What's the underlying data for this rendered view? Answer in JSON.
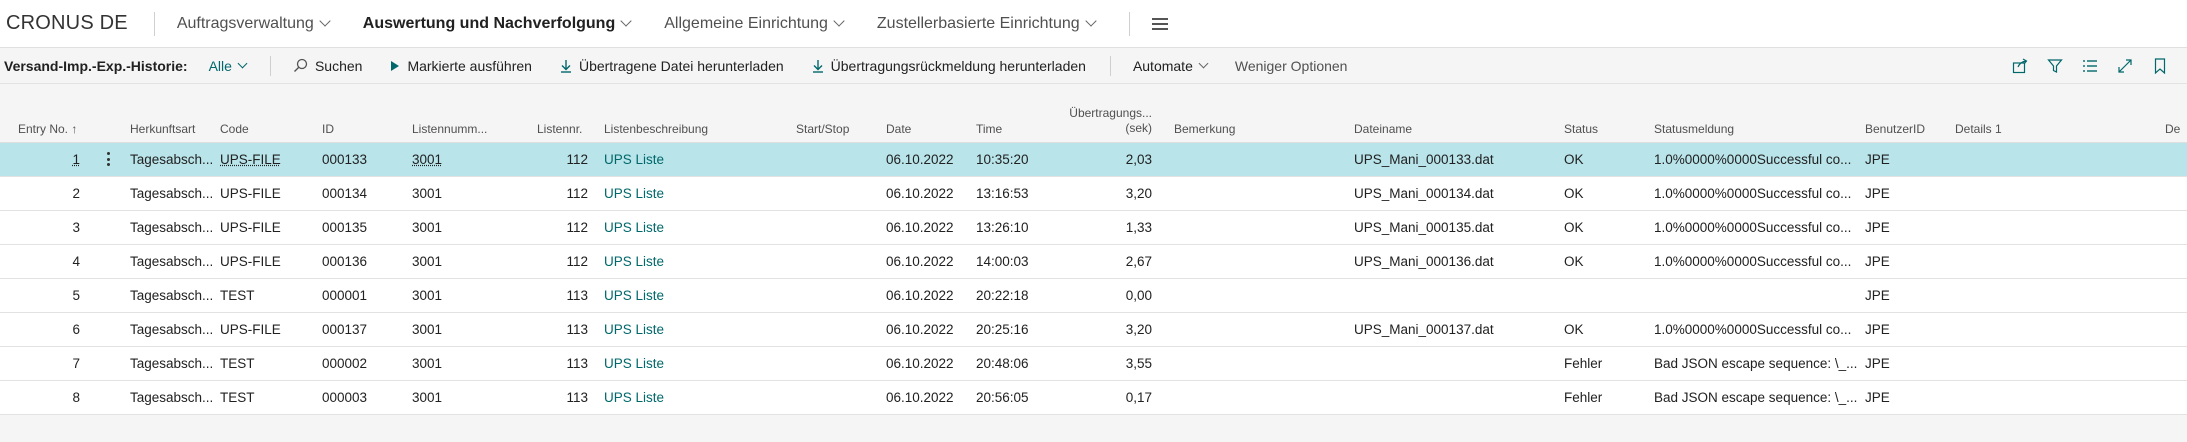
{
  "nav": {
    "brand": "CRONUS DE",
    "items": [
      {
        "label": "Auftragsverwaltung"
      },
      {
        "label": "Auswertung und Nachverfolgung"
      },
      {
        "label": "Allgemeine Einrichtung"
      },
      {
        "label": "Zustellerbasierte Einrichtung"
      }
    ]
  },
  "actionbar": {
    "title": "Versand-Imp.-Exp.-Historie:",
    "filter": "Alle",
    "search": "Suchen",
    "run_selected": "Markierte ausführen",
    "download_file": "Übertragene Datei herunterladen",
    "download_feedback": "Übertragungsrückmeldung herunterladen",
    "automate": "Automate",
    "fewer_options": "Weniger Optionen"
  },
  "table": {
    "headers": {
      "entry_no": "Entry No.",
      "herkunftsart": "Herkunftsart",
      "code": "Code",
      "id": "ID",
      "listennummer": "Listennumm...",
      "listennr": "Listennr.",
      "listenbeschreibung": "Listenbeschreibung",
      "start_stop": "Start/Stop",
      "date": "Date",
      "time": "Time",
      "uebertragung_1": "Übertragungs...",
      "uebertragung_2": "(sek)",
      "bemerkung": "Bemerkung",
      "dateiname": "Dateiname",
      "status": "Status",
      "statusmeldung": "Statusmeldung",
      "benutzerid": "BenutzerID",
      "details1": "Details 1",
      "de": "De"
    },
    "rows": [
      {
        "entry": "1",
        "herkunft": "Tagesabsch...",
        "code": "UPS-FILE",
        "id": "000133",
        "listennummer": "3001",
        "listennr": "112",
        "beschreibung": "UPS Liste",
        "date": "06.10.2022",
        "time": "10:35:20",
        "sek": "2,03",
        "datei": "UPS_Mani_000133.dat",
        "status": "OK",
        "meldung": "1.0%0000%0000Successful co...",
        "user": "JPE"
      },
      {
        "entry": "2",
        "herkunft": "Tagesabsch...",
        "code": "UPS-FILE",
        "id": "000134",
        "listennummer": "3001",
        "listennr": "112",
        "beschreibung": "UPS Liste",
        "date": "06.10.2022",
        "time": "13:16:53",
        "sek": "3,20",
        "datei": "UPS_Mani_000134.dat",
        "status": "OK",
        "meldung": "1.0%0000%0000Successful co...",
        "user": "JPE"
      },
      {
        "entry": "3",
        "herkunft": "Tagesabsch...",
        "code": "UPS-FILE",
        "id": "000135",
        "listennummer": "3001",
        "listennr": "112",
        "beschreibung": "UPS Liste",
        "date": "06.10.2022",
        "time": "13:26:10",
        "sek": "1,33",
        "datei": "UPS_Mani_000135.dat",
        "status": "OK",
        "meldung": "1.0%0000%0000Successful co...",
        "user": "JPE"
      },
      {
        "entry": "4",
        "herkunft": "Tagesabsch...",
        "code": "UPS-FILE",
        "id": "000136",
        "listennummer": "3001",
        "listennr": "112",
        "beschreibung": "UPS Liste",
        "date": "06.10.2022",
        "time": "14:00:03",
        "sek": "2,67",
        "datei": "UPS_Mani_000136.dat",
        "status": "OK",
        "meldung": "1.0%0000%0000Successful co...",
        "user": "JPE"
      },
      {
        "entry": "5",
        "herkunft": "Tagesabsch...",
        "code": "TEST",
        "id": "000001",
        "listennummer": "3001",
        "listennr": "113",
        "beschreibung": "UPS Liste",
        "date": "06.10.2022",
        "time": "20:22:18",
        "sek": "0,00",
        "datei": "",
        "status": "",
        "meldung": "",
        "user": "JPE"
      },
      {
        "entry": "6",
        "herkunft": "Tagesabsch...",
        "code": "UPS-FILE",
        "id": "000137",
        "listennummer": "3001",
        "listennr": "113",
        "beschreibung": "UPS Liste",
        "date": "06.10.2022",
        "time": "20:25:16",
        "sek": "3,20",
        "datei": "UPS_Mani_000137.dat",
        "status": "OK",
        "meldung": "1.0%0000%0000Successful co...",
        "user": "JPE"
      },
      {
        "entry": "7",
        "herkunft": "Tagesabsch...",
        "code": "TEST",
        "id": "000002",
        "listennummer": "3001",
        "listennr": "113",
        "beschreibung": "UPS Liste",
        "date": "06.10.2022",
        "time": "20:48:06",
        "sek": "3,55",
        "datei": "",
        "status": "Fehler",
        "meldung": "Bad JSON escape sequence: \\_...",
        "user": "JPE"
      },
      {
        "entry": "8",
        "herkunft": "Tagesabsch...",
        "code": "TEST",
        "id": "000003",
        "listennummer": "3001",
        "listennr": "113",
        "beschreibung": "UPS Liste",
        "date": "06.10.2022",
        "time": "20:56:05",
        "sek": "0,17",
        "datei": "",
        "status": "Fehler",
        "meldung": "Bad JSON escape sequence: \\_...",
        "user": "JPE"
      }
    ]
  },
  "colors": {
    "accent": "#00686b",
    "selected_row": "#b8e4ea"
  }
}
